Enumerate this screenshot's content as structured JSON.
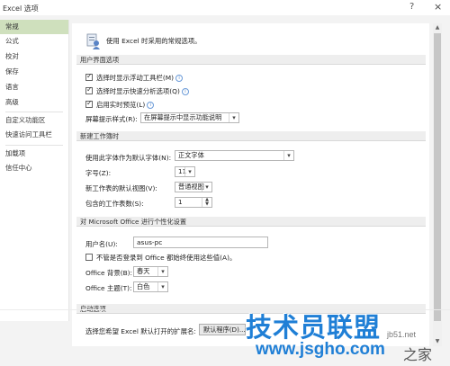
{
  "window": {
    "title": "Excel 选项",
    "help": "?",
    "close": "×"
  },
  "sidebar": {
    "items": [
      {
        "label": "常规",
        "selected": true
      },
      {
        "label": "公式"
      },
      {
        "label": "校对"
      },
      {
        "label": "保存"
      },
      {
        "label": "语言"
      },
      {
        "label": "高级"
      },
      {
        "label": "自定义功能区"
      },
      {
        "label": "快速访问工具栏"
      },
      {
        "label": "加载项"
      },
      {
        "label": "信任中心"
      }
    ]
  },
  "main": {
    "intro": "使用 Excel 时采用的常规选项。",
    "ui_section": {
      "header": "用户界面选项",
      "mini_toolbar": "选择时显示浮动工具栏(M)",
      "quick_analysis": "选择时显示快速分析选项(Q)",
      "live_preview": "启用实时预览(L)",
      "tooltip_label": "屏幕提示样式(R):",
      "tooltip_value": "在屏幕提示中显示功能说明"
    },
    "new_wb_section": {
      "header": "新建工作簿时",
      "font_label": "使用此字体作为默认字体(N):",
      "font_value": "正文字体",
      "size_label": "字号(Z):",
      "size_value": "11",
      "view_label": "新工作表的默认视图(V):",
      "view_value": "普通视图",
      "sheets_label": "包含的工作表数(S):",
      "sheets_value": "1"
    },
    "personalize_section": {
      "header": "对 Microsoft Office 进行个性化设置",
      "username_label": "用户名(U):",
      "username_value": "asus-pc",
      "always_use": "不管是否登录到 Office 都始终使用这些值(A)。",
      "background_label": "Office 背景(B):",
      "background_value": "春天",
      "theme_label": "Office 主题(T):",
      "theme_value": "白色"
    },
    "startup_section": {
      "header": "启动选项",
      "extensions_label": "选择您希望 Excel 默认打开的扩展名:",
      "default_programs_button": "默认程序(D)..."
    }
  },
  "watermark": {
    "brand": "技术员联盟",
    "site": "www.jsgho.com",
    "tag": "jb51.net",
    "corner": "之家"
  }
}
